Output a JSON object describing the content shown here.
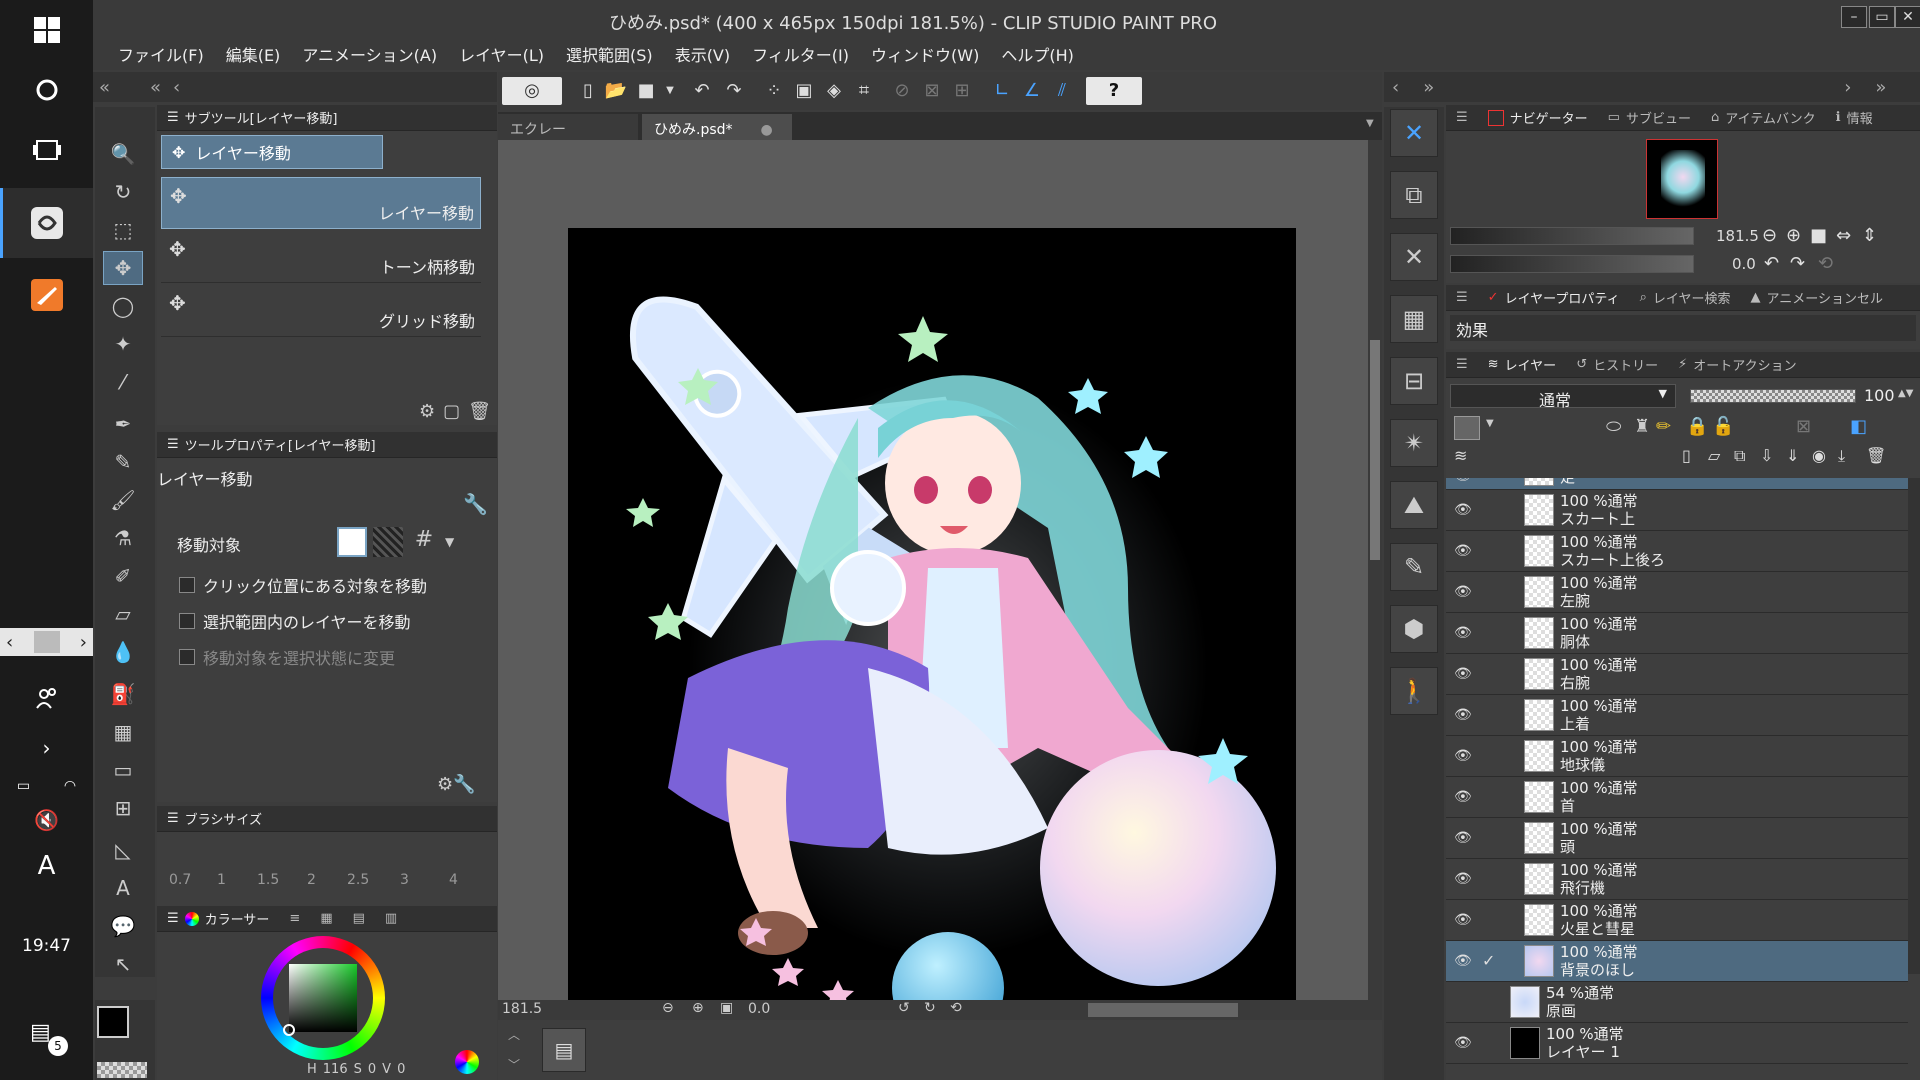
{
  "window": {
    "title": "ひめみ.psd* (400 x 465px 150dpi 181.5%) - CLIP STUDIO PAINT PRO"
  },
  "menu": [
    "ファイル(F)",
    "編集(E)",
    "アニメーション(A)",
    "レイヤー(L)",
    "選択範囲(S)",
    "表示(V)",
    "フィルター(I)",
    "ウィンドウ(W)",
    "ヘルプ(H)"
  ],
  "taskbar": {
    "clock": "19:47",
    "notifications": "5",
    "ime": "A"
  },
  "subtool": {
    "header": "サブツール[レイヤー移動]",
    "group": "レイヤー移動",
    "items": [
      "レイヤー移動",
      "トーン柄移動",
      "グリッド移動"
    ]
  },
  "toolprop": {
    "header": "ツールプロパティ[レイヤー移動]",
    "tool_name": "レイヤー移動",
    "move_target_label": "移動対象",
    "options": [
      "クリック位置にある対象を移動",
      "選択範囲内のレイヤーを移動",
      "移動対象を選択状態に変更"
    ]
  },
  "brushsize": {
    "header": "ブラシサイズ",
    "sizes": [
      "0.7",
      "1",
      "1.5",
      "2",
      "2.5",
      "3",
      "4"
    ]
  },
  "colorpanel": {
    "header": "カラーサー",
    "h": "116",
    "s": "0",
    "v": "0",
    "h_label": "H",
    "s_label": "S",
    "v_label": "V"
  },
  "documents": [
    {
      "name": "エクレール.psd*",
      "active": false
    },
    {
      "name": "ひめみ.psd*",
      "active": true
    }
  ],
  "canvas_status": {
    "zoom": "181.5",
    "angle": "0.0"
  },
  "navigator": {
    "tabs": [
      "ナビゲーター",
      "サブビュー",
      "アイテムバンク",
      "情報"
    ],
    "zoom": "181.5",
    "angle": "0.0"
  },
  "layerprop": {
    "tabs": [
      "レイヤープロパティ",
      "レイヤー検索",
      "アニメーションセル"
    ],
    "effect_label": "効果"
  },
  "layerpanel": {
    "tabs": [
      "レイヤー",
      "ヒストリー",
      "オートアクション"
    ],
    "blend_mode": "通常",
    "opacity": "100",
    "layers": [
      {
        "opacity": "",
        "mode": "",
        "name": "足",
        "selected": true
      },
      {
        "opacity": "100 %",
        "mode": "通常",
        "name": "スカート上"
      },
      {
        "opacity": "100 %",
        "mode": "通常",
        "name": "スカート上後ろ"
      },
      {
        "opacity": "100 %",
        "mode": "通常",
        "name": "左腕"
      },
      {
        "opacity": "100 %",
        "mode": "通常",
        "name": "胴体"
      },
      {
        "opacity": "100 %",
        "mode": "通常",
        "name": "右腕"
      },
      {
        "opacity": "100 %",
        "mode": "通常",
        "name": "上着"
      },
      {
        "opacity": "100 %",
        "mode": "通常",
        "name": "地球儀"
      },
      {
        "opacity": "100 %",
        "mode": "通常",
        "name": "首"
      },
      {
        "opacity": "100 %",
        "mode": "通常",
        "name": "頭"
      },
      {
        "opacity": "100 %",
        "mode": "通常",
        "name": "飛行機"
      },
      {
        "opacity": "100 %",
        "mode": "通常",
        "name": "火星と彗星"
      },
      {
        "opacity": "100 %",
        "mode": "通常",
        "name": "背景のほし",
        "selected": true
      },
      {
        "opacity": "54 %",
        "mode": "通常",
        "name": "原画"
      },
      {
        "opacity": "100 %",
        "mode": "通常",
        "name": "レイヤー 1"
      }
    ]
  },
  "colors": {
    "accent": "#5b7a93",
    "panel": "#3e3e3e",
    "header": "#313131"
  }
}
